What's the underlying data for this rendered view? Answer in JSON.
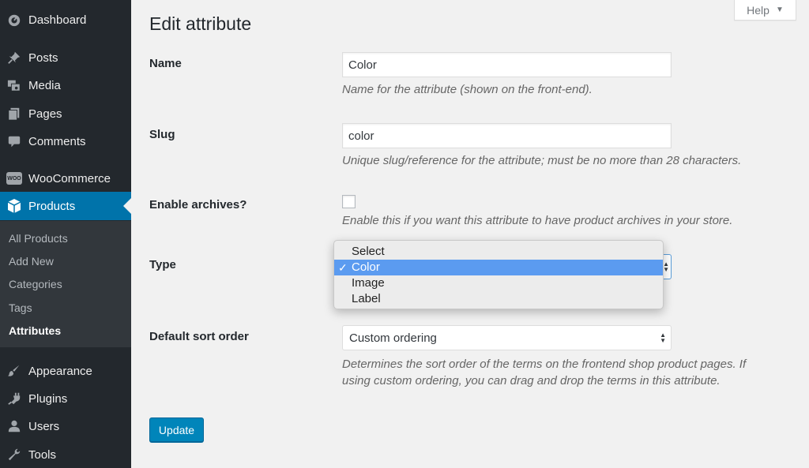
{
  "sidebar": {
    "items": [
      {
        "label": "Dashboard",
        "icon": "dashboard-icon"
      },
      {
        "label": "Posts",
        "icon": "pin-icon"
      },
      {
        "label": "Media",
        "icon": "media-icon"
      },
      {
        "label": "Pages",
        "icon": "pages-icon"
      },
      {
        "label": "Comments",
        "icon": "comment-icon"
      },
      {
        "label": "WooCommerce",
        "icon": "woocommerce-icon",
        "badge": "WOO"
      },
      {
        "label": "Products",
        "icon": "products-icon"
      },
      {
        "label": "Appearance",
        "icon": "brush-icon"
      },
      {
        "label": "Plugins",
        "icon": "plugin-icon"
      },
      {
        "label": "Users",
        "icon": "users-icon"
      },
      {
        "label": "Tools",
        "icon": "wrench-icon"
      }
    ],
    "submenu": [
      "All Products",
      "Add New",
      "Categories",
      "Tags",
      "Attributes"
    ]
  },
  "help": {
    "label": "Help"
  },
  "page": {
    "title": "Edit attribute"
  },
  "form": {
    "name": {
      "label": "Name",
      "value": "Color",
      "desc": "Name for the attribute (shown on the front-end)."
    },
    "slug": {
      "label": "Slug",
      "value": "color",
      "desc": "Unique slug/reference for the attribute; must be no more than 28 characters."
    },
    "archives": {
      "label": "Enable archives?",
      "checked": false,
      "desc": "Enable this if you want this attribute to have product archives in your store."
    },
    "type": {
      "label": "Type",
      "options": [
        "Select",
        "Color",
        "Image",
        "Label"
      ],
      "selected": "Color"
    },
    "sort": {
      "label": "Default sort order",
      "value": "Custom ordering",
      "desc_line1": "Determines the sort order of the terms on the frontend shop product pages. If",
      "desc_line2": "using custom ordering, you can drag and drop the terms in this attribute."
    },
    "update_label": "Update"
  },
  "colors": {
    "sidebar": "#23282d",
    "submenu": "#32373c",
    "accent": "#0073aa",
    "button": "#0085ba",
    "dropdown_highlight": "#5b9bf0"
  }
}
